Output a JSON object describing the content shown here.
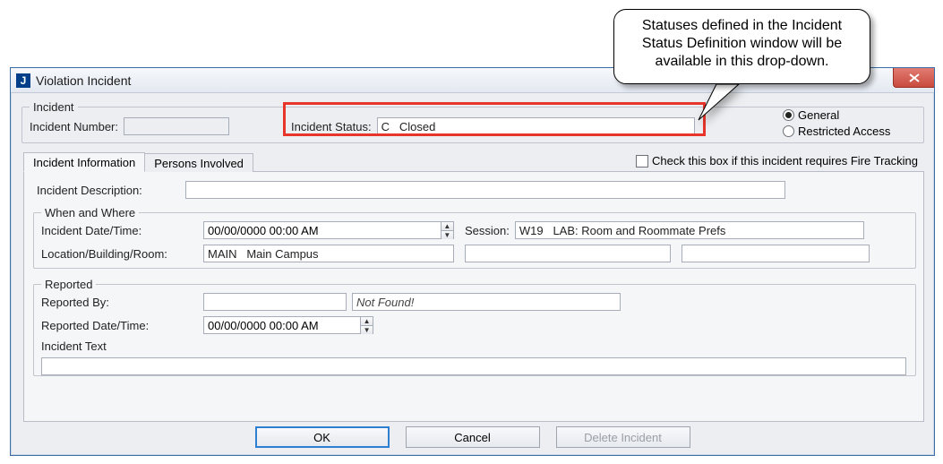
{
  "callout": {
    "text": "Statuses defined in the Incident Status Definition window will be available in this drop-down."
  },
  "window": {
    "title": "Violation Incident"
  },
  "incident_group": {
    "legend": "Incident",
    "number_label": "Incident Number:",
    "number_value": "",
    "status_label": "Incident Status:",
    "status_value": "C   Closed"
  },
  "access_radio": {
    "general": "General",
    "restricted": "Restricted Access"
  },
  "tabs": {
    "info": "Incident Information",
    "persons": "Persons Involved"
  },
  "fire_checkbox": "Check this box if this incident requires Fire Tracking",
  "panel": {
    "desc_label": "Incident Description:",
    "desc_value": "",
    "whenwhere_legend": "When and Where",
    "datetime_label": "Incident Date/Time:",
    "datetime_value": "00/00/0000 00:00 AM",
    "session_label": "Session:",
    "session_value": "W19   LAB: Room and Roommate Prefs",
    "location_label": "Location/Building/Room:",
    "location_value": "MAIN   Main Campus",
    "location_extra1": "",
    "location_extra2": "",
    "reported_legend": "Reported",
    "reportedby_label": "Reported By:",
    "reportedby_value": "",
    "reportedby_msg": "Not Found!",
    "reported_dt_label": "Reported Date/Time:",
    "reported_dt_value": "00/00/0000 00:00 AM",
    "incident_text_label": "Incident Text",
    "incident_text_value": ""
  },
  "buttons": {
    "ok": "OK",
    "cancel": "Cancel",
    "delete": "Delete Incident"
  }
}
